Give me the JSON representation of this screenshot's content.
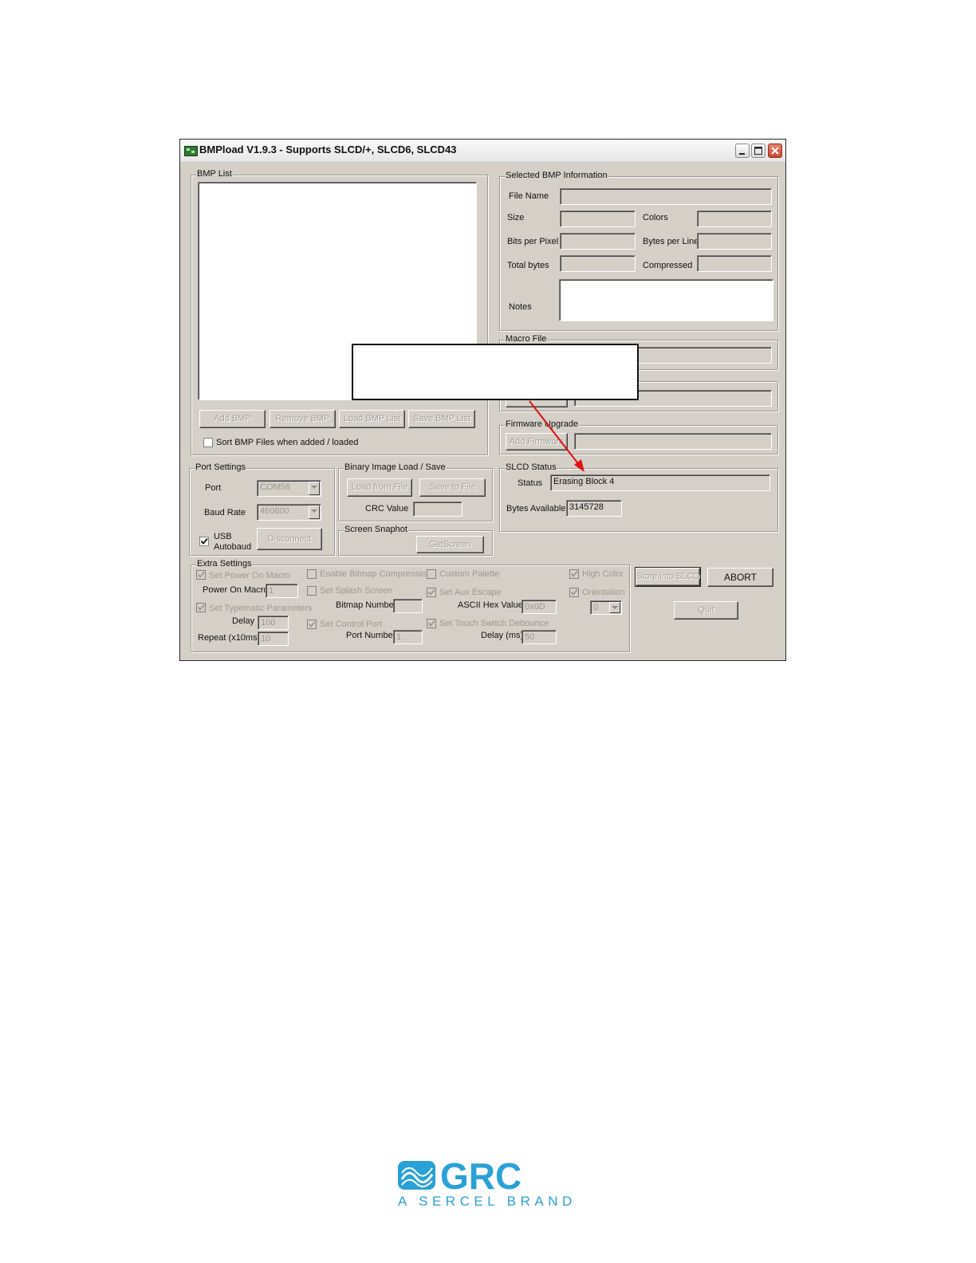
{
  "window": {
    "title": "BMPload V1.9.3 - Supports SLCD/+, SLCD6, SLCD43",
    "app_icon": "circuit-board-icon",
    "controls": [
      "minimize-icon",
      "maximize-icon",
      "close-icon"
    ]
  },
  "bmp_list": {
    "label": "BMP List",
    "buttons": {
      "add": "Add BMP",
      "remove": "Remove BMP",
      "load": "Load BMP List",
      "save": "Save BMP List"
    },
    "sort_label": "Sort BMP Files when added / loaded",
    "sort_checked": false
  },
  "selected_info": {
    "label": "Selected BMP Information",
    "file_name_label": "File Name",
    "size_label": "Size",
    "colors_label": "Colors",
    "bpp_label": "Bits per Pixel",
    "bpl_label": "Bytes per Line",
    "total_label": "Total bytes",
    "compressed_label": "Compressed",
    "notes_label": "Notes"
  },
  "macro_file": {
    "label": "Macro File"
  },
  "firmware": {
    "label": "Firmware Upgrade",
    "button": "Add Firmware"
  },
  "slcd_status": {
    "label": "SLCD Status",
    "status_label": "Status",
    "status_value": "Erasing Block 4",
    "bytes_label": "Bytes Available",
    "bytes_value": "3145728"
  },
  "port_settings": {
    "label": "Port Settings",
    "port_label": "Port",
    "port_value": "COM58",
    "baud_label": "Baud Rate",
    "baud_value": "460800",
    "usb_label_1": "USB",
    "usb_label_2": "Autobaud",
    "usb_checked": true,
    "disconnect": "Disconnect"
  },
  "binary_image": {
    "label": "Binary Image Load / Save",
    "load": "Load from File",
    "save": "Save to File",
    "crc_label": "CRC Value"
  },
  "screen_snapshot": {
    "label": "Screen Snaphot",
    "button": "GetScreen"
  },
  "extra_settings": {
    "label": "Extra Settings",
    "power_on_macro": "Set Power On Macro",
    "power_on_macro_label": "Power On Macro",
    "power_on_macro_value": "1",
    "typematic": "Set Typematic Parameters",
    "delay_label": "Delay",
    "delay_value": "100",
    "repeat_label": "Repeat (x10ms)",
    "repeat_value": "10",
    "bitmap_compression": "Enable Bitmap Compression",
    "splash": "Set Splash Screen",
    "bitmap_number_label": "Bitmap Number",
    "control_port": "Set Control Port",
    "port_number_label": "Port Number",
    "port_number_value": "1",
    "custom_palette": "Custom Palette",
    "aux_escape": "Set Aux Escape",
    "ascii_hex_label": "ASCII Hex Value",
    "ascii_hex_value": "0x0D",
    "debounce": "Set Touch Switch Debounce",
    "debounce_delay_label": "Delay (ms)",
    "debounce_delay_value": "50",
    "high_color": "High Color",
    "orientation": "Orientation",
    "orientation_value": "0"
  },
  "actions": {
    "store": "Store into SLCD",
    "abort": "ABORT",
    "quit": "Quit"
  },
  "annotation": {
    "arrow_color": "#e01010"
  },
  "logo": {
    "text": "GRC",
    "tagline": "A SERCEL BRAND",
    "color": "#2aa1d6"
  }
}
